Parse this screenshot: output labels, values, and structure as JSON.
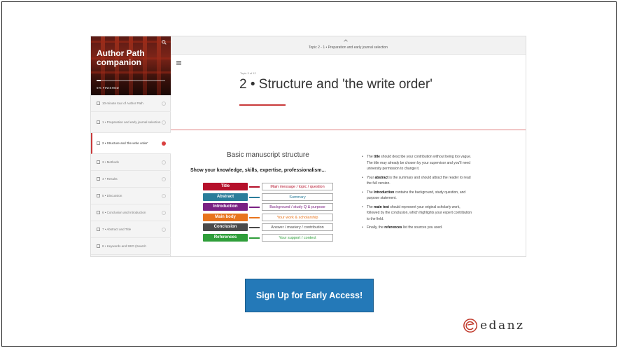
{
  "sidebar": {
    "title": "Author Path companion",
    "status": "6% FINISHED",
    "progress": 0.06,
    "items": [
      {
        "label": "10-minute tour of Author Path",
        "active": false
      },
      {
        "label": "1 • Preparation and early journal selection",
        "active": false
      },
      {
        "label": "2 • Structure and 'the write order'",
        "active": true
      },
      {
        "label": "3 • Methods",
        "active": false
      },
      {
        "label": "4 • Results",
        "active": false
      },
      {
        "label": "5 • Discussion",
        "active": false
      },
      {
        "label": "6 • Conclusion and Introduction",
        "active": false
      },
      {
        "label": "7 • Abstract and Title",
        "active": false
      },
      {
        "label": "8 • Keywords and SEO (Search",
        "active": false
      }
    ]
  },
  "topbar": {
    "breadcrumb": "Topic 2 - 1 • Preparation and early journal selection"
  },
  "lesson": {
    "count": "Topic 3 of 12",
    "title": "2 • Structure and 'the write order'"
  },
  "diagram": {
    "title": "Basic manuscript structure",
    "subtitle": "Show your knowledge, skills, expertise, professionalism...",
    "rows": [
      {
        "section": "Title",
        "description": "Main message / topic / question",
        "color": "#b5102a",
        "text_color": "#b5102a"
      },
      {
        "section": "Abstract",
        "description": "Summary",
        "color": "#2a7d9a",
        "text_color": "#2a7d9a"
      },
      {
        "section": "Introduction",
        "description": "Background / study Q & purpose",
        "color": "#7a2183",
        "text_color": "#7a2183"
      },
      {
        "section": "Main body",
        "description": "Your work & scholarship",
        "color": "#e8741c",
        "text_color": "#e8741c"
      },
      {
        "section": "Conclusion",
        "description": "Answer / mastery / contribution",
        "color": "#4a4a4a",
        "text_color": "#4a4a4a"
      },
      {
        "section": "References",
        "description": "Your support / context",
        "color": "#2f9e3a",
        "text_color": "#2f9e3a"
      }
    ]
  },
  "bullets": [
    {
      "pre": "The ",
      "bold": "title",
      "post": " should describe your contribution without being too vague. The title may already be chosen by your supervisor and you'll need university permission to change it."
    },
    {
      "pre": "Your ",
      "bold": "abstract",
      "post": " is the summary and should attract the reader to read the full version."
    },
    {
      "pre": "The ",
      "bold": "Introduction",
      "post": " contains the background, study question, and purpose statement."
    },
    {
      "pre": "The ",
      "bold": "main text",
      "post": " should represent your original scholarly work, followed by the conclusion, which highlights your expert contribution to the field."
    },
    {
      "pre": "Finally, the ",
      "bold": "references",
      "post": " list the sources you used."
    }
  ],
  "cta": {
    "label": "Sign Up for Early Access!"
  },
  "brand": {
    "name": "edanz",
    "color": "#c0392b"
  }
}
